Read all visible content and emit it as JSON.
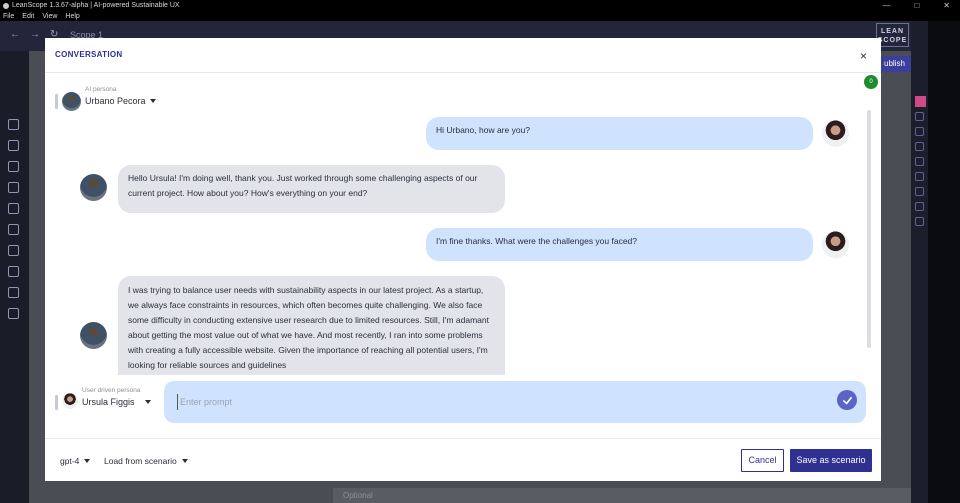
{
  "window": {
    "title": "LeanScope 1.3.67-alpha | AI-powered Sustainable UX",
    "controls": [
      "—",
      "□",
      "✕"
    ]
  },
  "menubar": [
    "File",
    "Edit",
    "View",
    "Help"
  ],
  "topbar": {
    "nav": [
      "←",
      "→",
      "↻"
    ],
    "scope": "Scope 1",
    "logo": "LEAN SCOPE",
    "publish": "ublish"
  },
  "modal": {
    "title": "CONVERSATION",
    "close": "×",
    "badge": "0",
    "ai_persona": {
      "caption": "AI persona",
      "name": "Urbano Pecora"
    },
    "user_persona": {
      "caption": "User driven persona",
      "name": "Ursula Figgis"
    },
    "messages": [
      {
        "role": "user",
        "text": "Hi Urbano, how are you?"
      },
      {
        "role": "ai",
        "text": "Hello Ursula! I'm doing well, thank you. Just worked through some challenging aspects of our current project. How about you? How's everything on your end?"
      },
      {
        "role": "user",
        "text": "I'm fine thanks. What were the challenges you faced?"
      },
      {
        "role": "ai",
        "text": "I was trying to balance user needs with sustainability aspects in our latest project. As a startup, we always face constraints in resources, which often becomes quite challenging. We also face some difficulty in conducting extensive user research due to limited resources. Still, I'm adamant about getting the most value out of what we have. And most recently, I ran into some problems with creating a fully accessible website. Given the importance of reaching all potential users, I'm looking for reliable sources and guidelines"
      }
    ],
    "prompt": {
      "placeholder": "Enter prompt",
      "value": ""
    },
    "footer": {
      "model": "gpt-4",
      "load_scenario": "Load from scenario",
      "cancel": "Cancel",
      "save": "Save as scenario"
    }
  },
  "background": {
    "optional_hint": "Optional"
  }
}
